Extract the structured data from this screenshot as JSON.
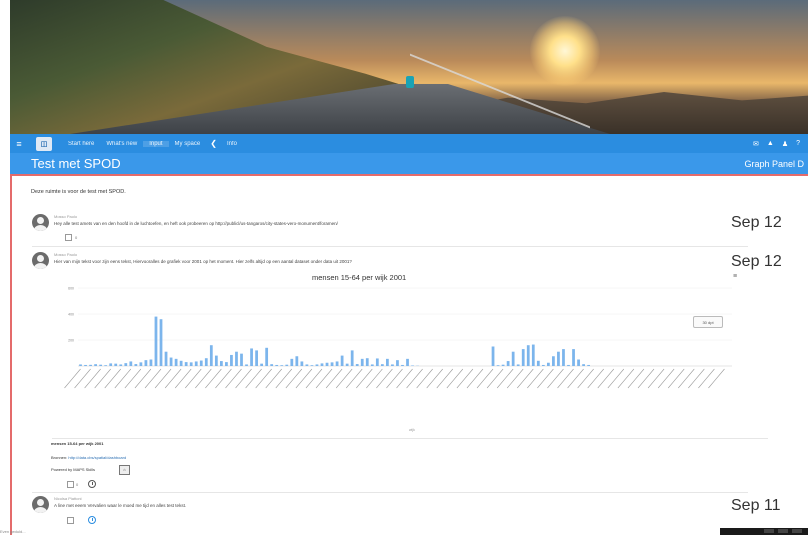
{
  "nav": {
    "items": [
      "Start here",
      "What's new",
      "Input",
      "My space"
    ],
    "active_index": 2,
    "extra": "Info"
  },
  "title_bar": {
    "title": "Test met SPOD",
    "right": "Graph Panel D"
  },
  "page": {
    "description": "Deze ruimte is voor de test met SPOD."
  },
  "posts": [
    {
      "author": "Mosso Paolo",
      "text": "Hey alle test amets van en den hoofd in de luchtoefen, en heft ook probeeren op http://publicl/us-tangaros/city-states-vero-monument/foramen/",
      "date": "Sep 12",
      "count": "0"
    },
    {
      "author": "Mosso Paolo",
      "text": "Hier van mijn tekst voor zijn eens tekst, Hiervooralles de grafiek voor 2001 op het moment. Hier zelfs altijd op een aantal dataset onder data uit 2001?",
      "date": "Sep 12"
    },
    {
      "author": "Nicolsa Piattoni",
      "text": "A line met eeem Vervalien waar le moed me tijd en alles test tekst.",
      "date": "Sep 11"
    }
  ],
  "chart_data": {
    "type": "bar",
    "title": "mensen 15-64 per wijk 2001",
    "xlabel": "wijk",
    "ylim": [
      0,
      600
    ],
    "y_ticks": [
      "600",
      "400",
      "200"
    ],
    "legend": "",
    "button": "30 dpt",
    "values": [
      12,
      8,
      9,
      14,
      10,
      6,
      20,
      18,
      12,
      22,
      35,
      15,
      28,
      45,
      50,
      380,
      360,
      110,
      65,
      55,
      40,
      30,
      28,
      35,
      42,
      60,
      160,
      80,
      38,
      30,
      85,
      110,
      95,
      12,
      135,
      120,
      18,
      140,
      14,
      8,
      6,
      10,
      55,
      75,
      35,
      12,
      6,
      12,
      20,
      25,
      28,
      35,
      80,
      18,
      120,
      15,
      55,
      60,
      12,
      58,
      14,
      55,
      12,
      45,
      8,
      55,
      4,
      2,
      0,
      0,
      0,
      0,
      0,
      0,
      0,
      0,
      0,
      0,
      0,
      0,
      0,
      0,
      150,
      6,
      10,
      38,
      110,
      12,
      130,
      160,
      165,
      40,
      8,
      25,
      75,
      110,
      130,
      8,
      130,
      50,
      14,
      8,
      0,
      0,
      0,
      0,
      0,
      0,
      0,
      0,
      0,
      0,
      0,
      0,
      0,
      0,
      0,
      0,
      0,
      0,
      0,
      0,
      0,
      0,
      0,
      0,
      0,
      0,
      0,
      0
    ]
  },
  "chart_footer": {
    "caption": "mensen 15-64 per wijk 2001",
    "source_label": "Bronnen:",
    "source_link": "http://data.cbs/spatial/dashboard",
    "powered_label": "Powered by MAPS Skills",
    "count": "0"
  },
  "status_bar": {
    "text": "Even geduld..."
  }
}
